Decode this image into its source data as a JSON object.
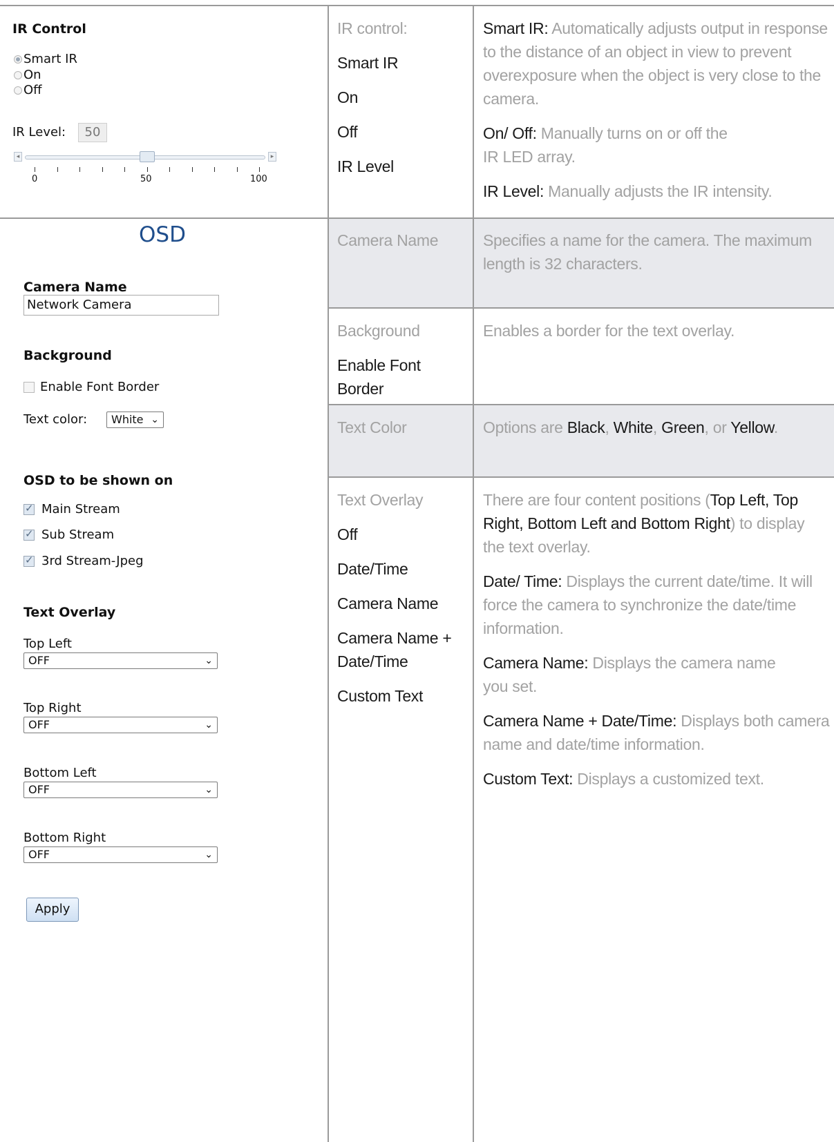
{
  "ir_panel": {
    "title": "IR Control",
    "options": [
      {
        "label": "Smart IR",
        "selected": true
      },
      {
        "label": "On",
        "selected": false
      },
      {
        "label": "Off",
        "selected": false
      }
    ],
    "level_label": "IR Level:",
    "level_value": "50",
    "slider_level": 0.5,
    "ticks": {
      "min": "0",
      "mid": "50",
      "max": "100"
    }
  },
  "osd_panel": {
    "title": "OSD",
    "camera_name_label": "Camera Name",
    "camera_name_value": "Network Camera",
    "background_label": "Background",
    "font_border_label": "Enable Font Border",
    "font_border_checked": false,
    "text_color_label": "Text color:",
    "text_color_value": "White",
    "shown_on_label": "OSD to be shown on",
    "streams": [
      {
        "label": "Main Stream",
        "checked": true
      },
      {
        "label": "Sub Stream",
        "checked": true
      },
      {
        "label": "3rd Stream-Jpeg",
        "checked": true
      }
    ],
    "overlay_label": "Text Overlay",
    "overlay_positions": [
      {
        "label": "Top Left",
        "value": "OFF"
      },
      {
        "label": "Top Right",
        "value": "OFF"
      },
      {
        "label": "Bottom Left",
        "value": "OFF"
      },
      {
        "label": "Bottom Right",
        "value": "OFF"
      }
    ],
    "apply_label": "Apply"
  },
  "rows": {
    "ir": {
      "heading": "IR control:",
      "items": [
        "Smart IR",
        "On",
        "Off",
        "IR Level"
      ],
      "desc_smart_term": "Smart IR:",
      "desc_smart_text": " Automatically adjusts output in response to the distance of an object in view to prevent overexposure when the object is very close to the camera.",
      "desc_onoff_term": "On/ Off:",
      "desc_onoff_text": " Manually turns on or off the IR LED array.",
      "desc_level_term": "IR Level:",
      "desc_level_text": " Manually adjusts the IR intensity."
    },
    "camera_name": {
      "heading": "Camera Name",
      "desc": "Specifies a name for the camera. The maximum length is 32 characters."
    },
    "background": {
      "heading": "Background",
      "item": "Enable Font Border",
      "desc": "Enables a border for the text overlay."
    },
    "text_color": {
      "heading": "Text Color",
      "desc_prefix": "Options are ",
      "c1": "Black",
      "sep1": ", ",
      "c2": "White",
      "sep2": ", ",
      "c3": "Green",
      "sep3": ", or ",
      "c4": "Yellow",
      "end": "."
    },
    "text_overlay": {
      "heading": "Text Overlay",
      "items": [
        "Off",
        "Date/Time",
        "Camera Name",
        "Camera Name + Date/Time",
        "Custom Text"
      ],
      "intro_a": "There are four content positions (",
      "intro_positions": "Top Left, Top Right, Bottom Left and Bottom Right",
      "intro_b": ") to display the text overlay.",
      "dt_term": "Date/ Time:",
      "dt_text": " Displays the current date/time. It will force the camera to synchronize the date/time information.",
      "cn_term": "Camera Name:",
      "cn_text": " Displays the camera name you set.",
      "cndt_term": "Camera Name + Date/Time:",
      "cndt_text": " Displays both camera name and date/time information.",
      "ct_term": "Custom Text:",
      "ct_text": " Displays a customized text."
    }
  },
  "colors": {
    "grid": "#9a9a9a",
    "shade": "#e8e9ed",
    "muted_text": "#a2a2a2",
    "osd_title": "#1f4e8c"
  }
}
